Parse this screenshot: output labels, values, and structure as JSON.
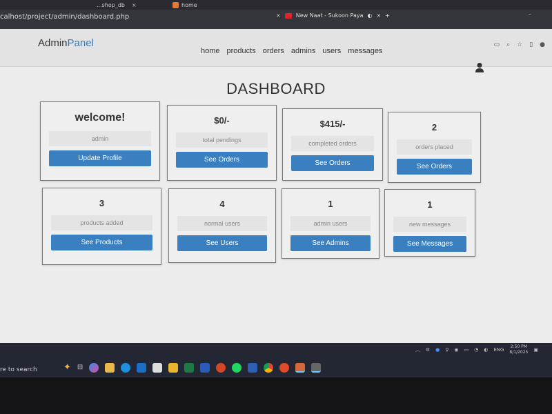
{
  "browser": {
    "tabs": [
      {
        "title": "...shop_db",
        "close": "×"
      },
      {
        "title": "home",
        "close": "×"
      },
      {
        "title": "New Naat - Sukoon Paya",
        "close": "×"
      }
    ],
    "new_tab": "+",
    "url": "calhost/project/admin/dashboard.php",
    "minimize": "–"
  },
  "header": {
    "logo_main": "Admin",
    "logo_accent": "Panel",
    "nav": [
      "home",
      "products",
      "orders",
      "admins",
      "users",
      "messages"
    ]
  },
  "page_title": "DASHBOARD",
  "cards": [
    {
      "value": "welcome!",
      "label": "admin",
      "button": "Update Profile"
    },
    {
      "value": "$0/-",
      "label": "total pendings",
      "button": "See Orders"
    },
    {
      "value": "$415/-",
      "label": "completed orders",
      "button": "See Orders"
    },
    {
      "value": "2",
      "label": "orders placed",
      "button": "See Orders"
    },
    {
      "value": "3",
      "label": "products added",
      "button": "See Products"
    },
    {
      "value": "4",
      "label": "normal users",
      "button": "See Users"
    },
    {
      "value": "1",
      "label": "admin users",
      "button": "See Admins"
    },
    {
      "value": "1",
      "label": "new messages",
      "button": "See Messages"
    }
  ],
  "taskbar": {
    "search_text": "re to search",
    "tray_lang": "ENG",
    "clock_time": "2:50 PM",
    "clock_date": "8/1/2025"
  },
  "colors": {
    "button": "#3a7fc0",
    "accent": "#3a7ab3",
    "page_bg": "#ececec"
  }
}
